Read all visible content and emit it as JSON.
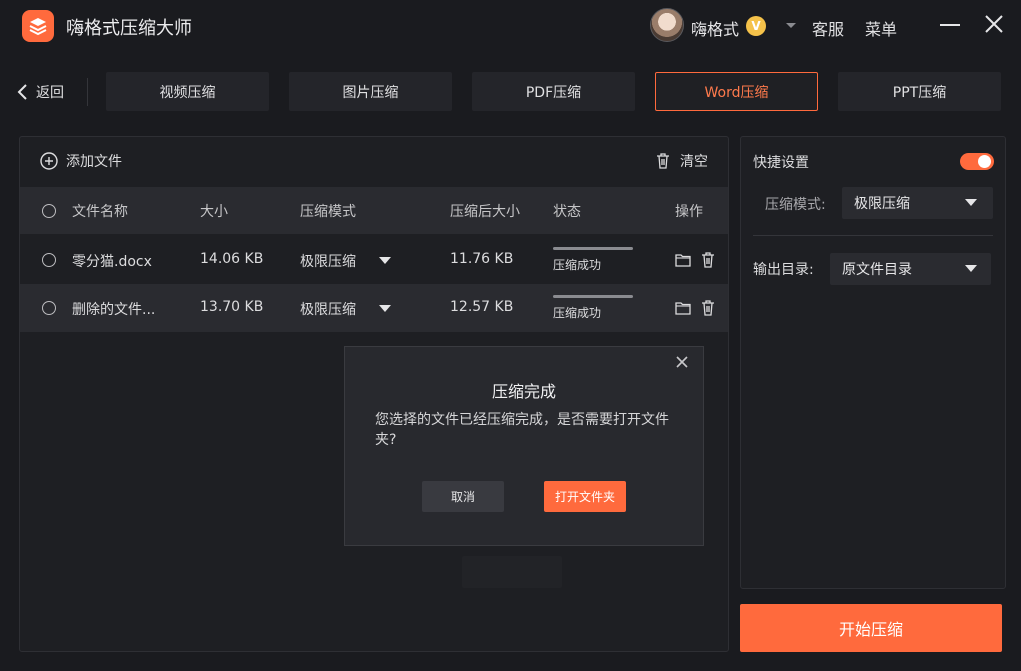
{
  "app": {
    "title": "嗨格式压缩大师",
    "username": "嗨格式",
    "vip_badge": "V",
    "customer_service": "客服",
    "menu": "菜单",
    "accent_color": "#ff6a3d"
  },
  "nav": {
    "back_label": "返回",
    "tabs": [
      {
        "label": "视频压缩",
        "active": false
      },
      {
        "label": "图片压缩",
        "active": false
      },
      {
        "label": "PDF压缩",
        "active": false
      },
      {
        "label": "Word压缩",
        "active": true
      },
      {
        "label": "PPT压缩",
        "active": false
      }
    ]
  },
  "file_panel": {
    "add_file_label": "添加文件",
    "clear_label": "清空",
    "columns": [
      "文件名称",
      "大小",
      "压缩模式",
      "压缩后大小",
      "状态",
      "操作"
    ],
    "rows": [
      {
        "name": "零分猫.docx",
        "size": "14.06 KB",
        "mode": "极限压缩",
        "compressed_size": "11.76 KB",
        "status": "压缩成功",
        "progress": 1.0
      },
      {
        "name": "删除的文件...",
        "size": "13.70 KB",
        "mode": "极限压缩",
        "compressed_size": "12.57 KB",
        "status": "压缩成功",
        "progress": 1.0
      }
    ]
  },
  "dialog": {
    "title": "压缩完成",
    "message": "您选择的文件已经压缩完成，是否需要打开文件夹?",
    "cancel_label": "取消",
    "open_folder_label": "打开文件夹"
  },
  "settings": {
    "quick_settings_label": "快捷设置",
    "quick_settings_enabled": true,
    "mode_label": "压缩模式:",
    "mode_value": "极限压缩",
    "output_label": "输出目录:",
    "output_value": "原文件目录",
    "start_button": "开始压缩"
  }
}
